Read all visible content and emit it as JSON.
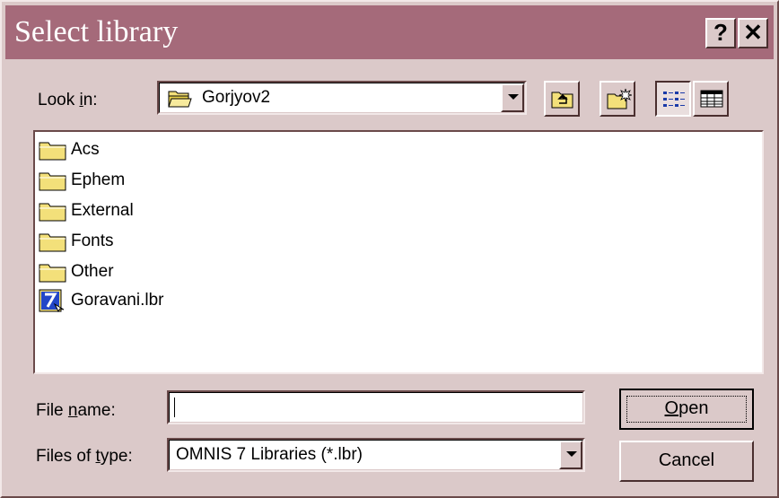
{
  "dialog": {
    "title": "Select library",
    "help_label": "?",
    "close_label": "✕"
  },
  "look_in": {
    "label_pre": "Look ",
    "label_key": "i",
    "label_post": "n:",
    "value": "Gorjyov2"
  },
  "toolbar": {
    "up_folder_icon": "up-folder-icon",
    "new_folder_icon": "new-folder-icon",
    "list_view_icon": "list-view-icon",
    "details_view_icon": "details-view-icon"
  },
  "files": {
    "items": [
      {
        "name": "Acs",
        "icon": "folder-icon"
      },
      {
        "name": "Ephem",
        "icon": "folder-icon"
      },
      {
        "name": "External",
        "icon": "folder-icon"
      },
      {
        "name": "Fonts",
        "icon": "folder-icon"
      },
      {
        "name": "Other",
        "icon": "folder-icon"
      },
      {
        "name": "Goravani.lbr",
        "icon": "omnis-library-icon"
      }
    ]
  },
  "file_name": {
    "label_pre": "File ",
    "label_key": "n",
    "label_post": "ame:",
    "value": ""
  },
  "file_type": {
    "label_pre": "Files of ",
    "label_key": "t",
    "label_post": "ype:",
    "value": "OMNIS 7 Libraries (*.lbr)"
  },
  "buttons": {
    "open_key": "O",
    "open_rest": "pen",
    "cancel": "Cancel"
  },
  "colors": {
    "titlebar": "#a56a7a",
    "face": "#dbc9c9",
    "folder": "#f3e07a"
  }
}
